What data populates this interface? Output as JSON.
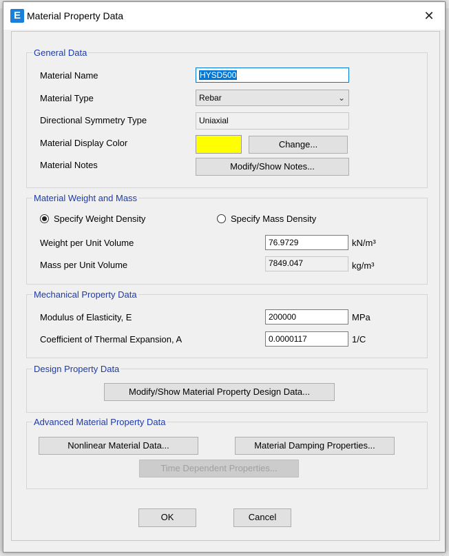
{
  "window": {
    "title": "Material Property Data",
    "app_icon_letter": "E",
    "close_glyph": "✕"
  },
  "general": {
    "legend": "General Data",
    "material_name_label": "Material Name",
    "material_name_value": "HYSD500",
    "material_type_label": "Material Type",
    "material_type_value": "Rebar",
    "symmetry_label": "Directional Symmetry Type",
    "symmetry_value": "Uniaxial",
    "display_color_label": "Material Display Color",
    "display_color_value": "#ffff00",
    "change_button": "Change...",
    "notes_label": "Material Notes",
    "notes_button": "Modify/Show Notes..."
  },
  "weight": {
    "legend": "Material Weight and Mass",
    "radio_weight": "Specify Weight Density",
    "radio_mass": "Specify Mass Density",
    "selected": "weight",
    "weight_label": "Weight per Unit Volume",
    "weight_value": "76.9729",
    "weight_unit": "kN/m³",
    "mass_label": "Mass per Unit Volume",
    "mass_value": "7849.047",
    "mass_unit": "kg/m³"
  },
  "mechanical": {
    "legend": "Mechanical Property Data",
    "modulus_label": "Modulus of Elasticity,  E",
    "modulus_value": "200000",
    "modulus_unit": "MPa",
    "thermal_label": "Coefficient of Thermal Expansion,  A",
    "thermal_value": "0.0000117",
    "thermal_unit": "1/C"
  },
  "design": {
    "legend": "Design Property Data",
    "button": "Modify/Show Material Property Design Data..."
  },
  "advanced": {
    "legend": "Advanced Material Property Data",
    "nonlinear_button": "Nonlinear Material Data...",
    "damping_button": "Material Damping Properties...",
    "time_button": "Time Dependent Properties..."
  },
  "footer": {
    "ok_button": "OK",
    "cancel_button": "Cancel"
  }
}
